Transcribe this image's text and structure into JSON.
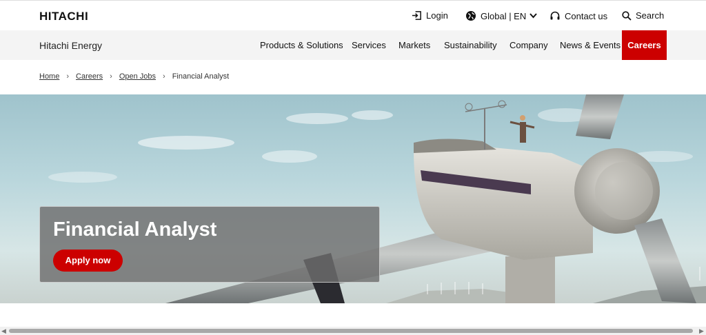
{
  "header": {
    "logo": "HITACHI",
    "login": "Login",
    "global": "Global | EN",
    "contact": "Contact us",
    "search": "Search"
  },
  "nav": {
    "brand": "Hitachi Energy",
    "items": [
      "Products & Solutions",
      "Services",
      "Markets",
      "Sustainability",
      "Company",
      "News & Events",
      "Careers"
    ],
    "active": "Careers",
    "accent_color": "#cc0000"
  },
  "breadcrumb": {
    "items": [
      "Home",
      "Careers",
      "Open Jobs",
      "Financial Analyst"
    ],
    "separator": "›"
  },
  "hero": {
    "title": "Financial Analyst",
    "apply_label": "Apply now"
  },
  "icons": {
    "login": "login-icon",
    "global": "globe-icon",
    "contact": "headset-icon",
    "search": "search-icon",
    "dropdown": "chevron-down-icon"
  }
}
